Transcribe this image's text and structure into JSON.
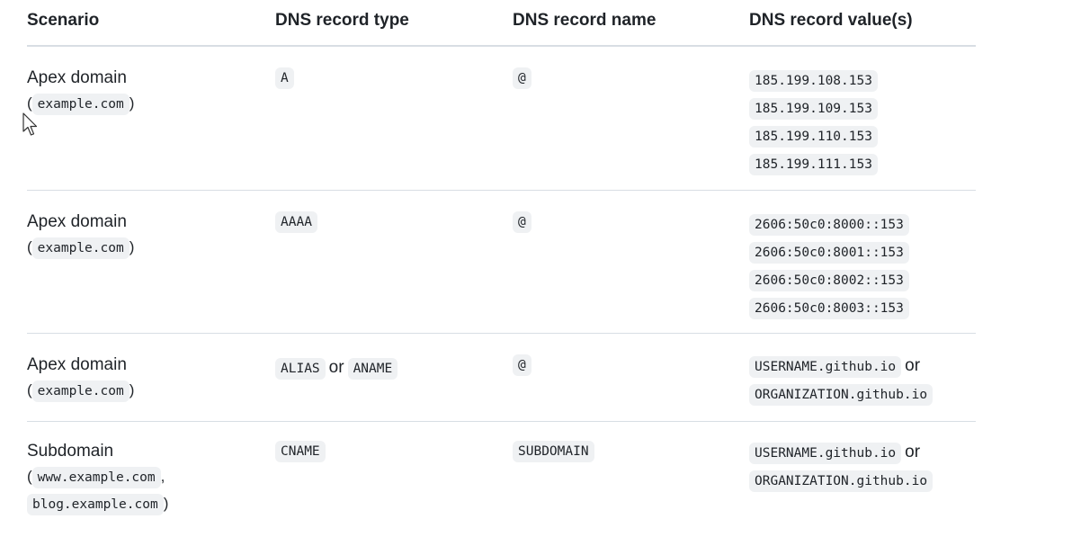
{
  "table": {
    "headers": [
      "Scenario",
      "DNS record type",
      "DNS record name",
      "DNS record value(s)"
    ],
    "connector": "or",
    "rows": [
      {
        "scenario_title": "Apex domain",
        "scenario_codes": [
          "example.com"
        ],
        "types": [
          "A"
        ],
        "name": "@",
        "values": [
          "185.199.108.153",
          "185.199.109.153",
          "185.199.110.153",
          "185.199.111.153"
        ]
      },
      {
        "scenario_title": "Apex domain",
        "scenario_codes": [
          "example.com"
        ],
        "types": [
          "AAAA"
        ],
        "name": "@",
        "values": [
          "2606:50c0:8000::153",
          "2606:50c0:8001::153",
          "2606:50c0:8002::153",
          "2606:50c0:8003::153"
        ]
      },
      {
        "scenario_title": "Apex domain",
        "scenario_codes": [
          "example.com"
        ],
        "types": [
          "ALIAS",
          "ANAME"
        ],
        "name": "@",
        "values": [
          "USERNAME.github.io",
          "ORGANIZATION.github.io"
        ]
      },
      {
        "scenario_title": "Subdomain",
        "scenario_codes": [
          "www.example.com",
          "blog.example.com"
        ],
        "types": [
          "CNAME"
        ],
        "name": "SUBDOMAIN",
        "values": [
          "USERNAME.github.io",
          "ORGANIZATION.github.io"
        ]
      }
    ]
  },
  "cursor": {
    "icon": "mouse-pointer-icon"
  }
}
